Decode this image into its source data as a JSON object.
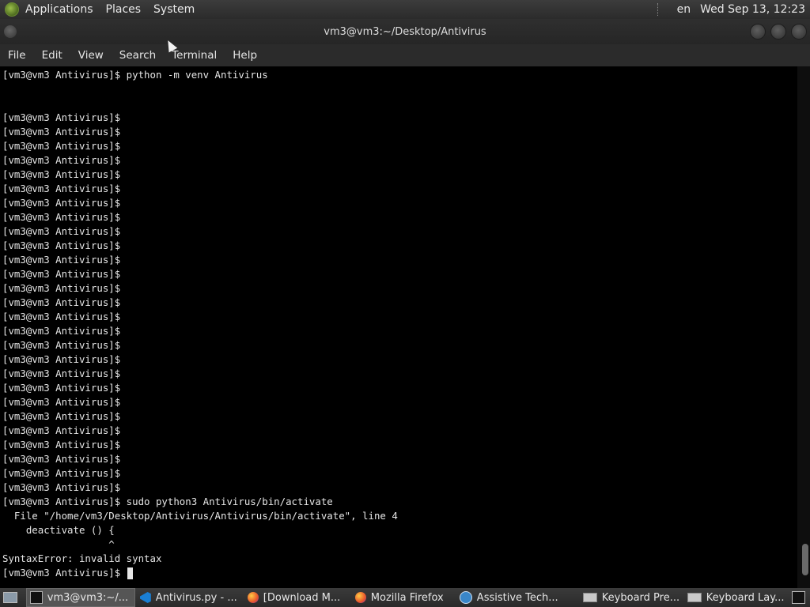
{
  "top_panel": {
    "menus": [
      "Applications",
      "Places",
      "System"
    ],
    "language": "en",
    "clock": "Wed Sep 13, 12:23"
  },
  "window": {
    "title": "vm3@vm3:~/Desktop/Antivirus"
  },
  "menubar": [
    "File",
    "Edit",
    "View",
    "Search",
    "Terminal",
    "Help"
  ],
  "terminal": {
    "lines": [
      "[vm3@vm3 Antivirus]$ python -m venv Antivirus",
      "",
      "",
      "[vm3@vm3 Antivirus]$",
      "[vm3@vm3 Antivirus]$",
      "[vm3@vm3 Antivirus]$",
      "[vm3@vm3 Antivirus]$",
      "[vm3@vm3 Antivirus]$",
      "[vm3@vm3 Antivirus]$",
      "[vm3@vm3 Antivirus]$",
      "[vm3@vm3 Antivirus]$",
      "[vm3@vm3 Antivirus]$",
      "[vm3@vm3 Antivirus]$",
      "[vm3@vm3 Antivirus]$",
      "[vm3@vm3 Antivirus]$",
      "[vm3@vm3 Antivirus]$",
      "[vm3@vm3 Antivirus]$",
      "[vm3@vm3 Antivirus]$",
      "[vm3@vm3 Antivirus]$",
      "[vm3@vm3 Antivirus]$",
      "[vm3@vm3 Antivirus]$",
      "[vm3@vm3 Antivirus]$",
      "[vm3@vm3 Antivirus]$",
      "[vm3@vm3 Antivirus]$",
      "[vm3@vm3 Antivirus]$",
      "[vm3@vm3 Antivirus]$",
      "[vm3@vm3 Antivirus]$",
      "[vm3@vm3 Antivirus]$",
      "[vm3@vm3 Antivirus]$",
      "[vm3@vm3 Antivirus]$",
      "[vm3@vm3 Antivirus]$ sudo python3 Antivirus/bin/activate",
      "  File \"/home/vm3/Desktop/Antivirus/Antivirus/bin/activate\", line 4",
      "    deactivate () {",
      "                  ^",
      "SyntaxError: invalid syntax",
      "[vm3@vm3 Antivirus]$ "
    ]
  },
  "taskbar": {
    "items": [
      {
        "label": "vm3@vm3:~/...",
        "icon": "terminal-icon",
        "active": true
      },
      {
        "label": "Antivirus.py - ...",
        "icon": "vscode-icon",
        "active": false
      },
      {
        "label": "[Download M...",
        "icon": "firefox-icon",
        "active": false
      },
      {
        "label": "Mozilla Firefox",
        "icon": "firefox-icon",
        "active": false
      },
      {
        "label": "Assistive Tech...",
        "icon": "accessibility-icon",
        "active": false
      },
      {
        "label": "Keyboard Pre...",
        "icon": "keyboard-icon",
        "active": false
      },
      {
        "label": "Keyboard Lay...",
        "icon": "keyboard-icon",
        "active": false
      }
    ]
  }
}
